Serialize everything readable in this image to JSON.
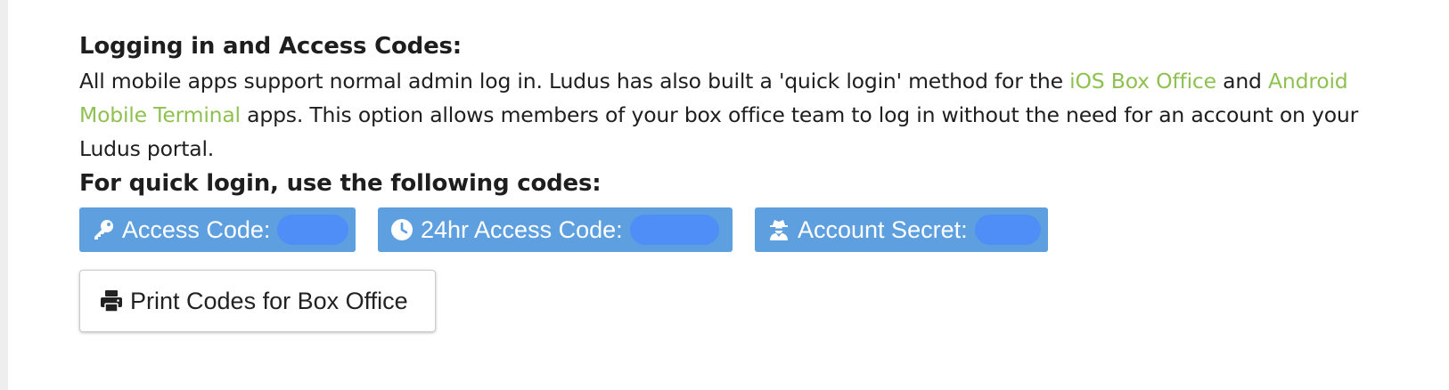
{
  "sections": {
    "login_title": "Logging in and Access Codes:",
    "intro": {
      "text_before": "All mobile apps support normal admin log in. Ludus has also built a 'quick login' method for the ",
      "ios_link": "iOS Box Office",
      "text_middle": " and ",
      "android_link": "Android Mobile Terminal",
      "text_after": " apps. This option allows members of your box office team to log in without the need for an account on your Ludus portal."
    },
    "quick_title": "For quick login, use the following codes:"
  },
  "codes": {
    "access_code_label": "Access Code:",
    "access_code_icon": "key-icon",
    "daily_code_label": "24hr Access Code:",
    "daily_code_icon": "clock-icon",
    "account_secret_label": "Account Secret:",
    "account_secret_icon": "user-secret-icon",
    "chip_color": "#5e9fe0",
    "redaction_color": "#4f8ef7"
  },
  "print_button": {
    "label": "Print Codes for Box Office",
    "icon": "printer-icon"
  },
  "link_color": "#8fc151"
}
